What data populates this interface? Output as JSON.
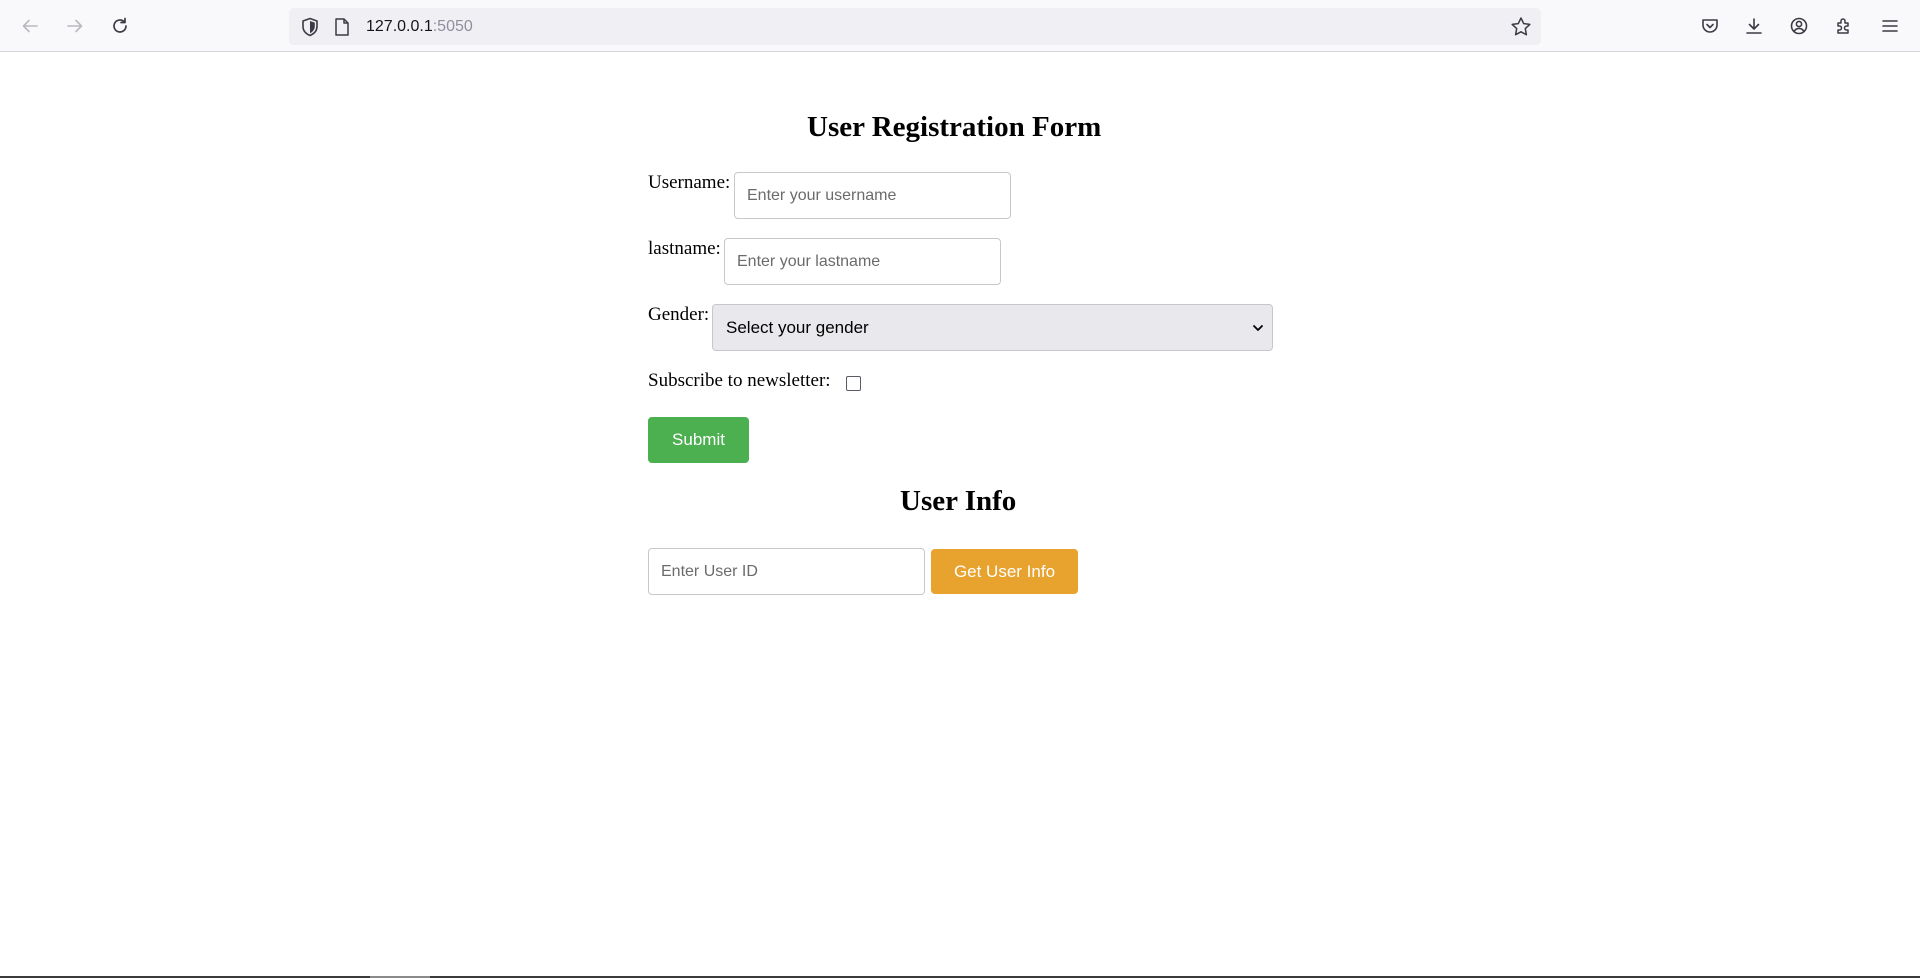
{
  "browser": {
    "url_host": "127.0.0.1",
    "url_port": ":5050",
    "icons": [
      "back-arrow-icon",
      "forward-arrow-icon",
      "reload-icon",
      "shield-icon",
      "page-icon",
      "bookmark-star-icon",
      "pocket-icon",
      "download-icon",
      "account-icon",
      "extensions-icon",
      "menu-icon"
    ]
  },
  "registration": {
    "title": "User Registration Form",
    "username_label": "Username:",
    "username_placeholder": "Enter your username",
    "lastname_label": "lastname:",
    "lastname_placeholder": "Enter your lastname",
    "gender_label": "Gender:",
    "gender_selected": "Select your gender",
    "newsletter_label": "Subscribe to newsletter:",
    "newsletter_checked": false,
    "submit_label": "Submit"
  },
  "user_info": {
    "title": "User Info",
    "userid_placeholder": "Enter User ID",
    "get_button_label": "Get User Info"
  },
  "colors": {
    "submit_button": "#4caf50",
    "get_info_button": "#e8a22e"
  }
}
